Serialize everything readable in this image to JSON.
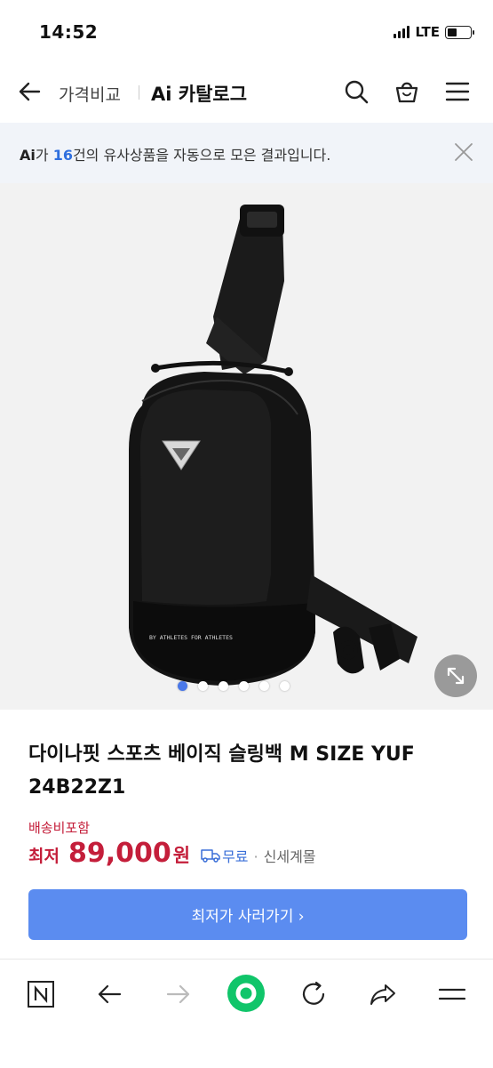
{
  "status": {
    "time": "14:52",
    "network": "LTE",
    "battery_level": 0.45
  },
  "nav": {
    "crumb": "가격비교",
    "title": "Ai 카탈로그"
  },
  "banner": {
    "ai": "Ai",
    "pre": "가 ",
    "count": "16",
    "post": "건의 유사상품을 자동으로 모은 결과입니다."
  },
  "product": {
    "image_label": "BY ATHLETES FOR ATHLETES",
    "title": "다이나핏 스포츠 베이직 슬링백 M SIZE YUF 24B22Z1",
    "shipping": "배송비포함",
    "price_label": "최저",
    "price": "89,000",
    "currency": "원",
    "free_shipping": "무료",
    "separator": "·",
    "mall": "신세계몰"
  },
  "carousel": {
    "total": 6,
    "active": 0
  },
  "cta": {
    "label": "최저가 사러가기 ›"
  },
  "colors": {
    "accent": "#5b8cf0",
    "price": "#c41e3a",
    "link": "#3a6fd8",
    "banner_bg": "#f1f4f9"
  },
  "icons": [
    "back-arrow-icon",
    "search-icon",
    "basket-icon",
    "menu-icon",
    "close-icon",
    "expand-icon",
    "truck-icon",
    "naver-home-icon",
    "nav-back-icon",
    "nav-forward-icon",
    "green-dot-icon",
    "refresh-icon",
    "share-icon",
    "more-menu-icon"
  ]
}
